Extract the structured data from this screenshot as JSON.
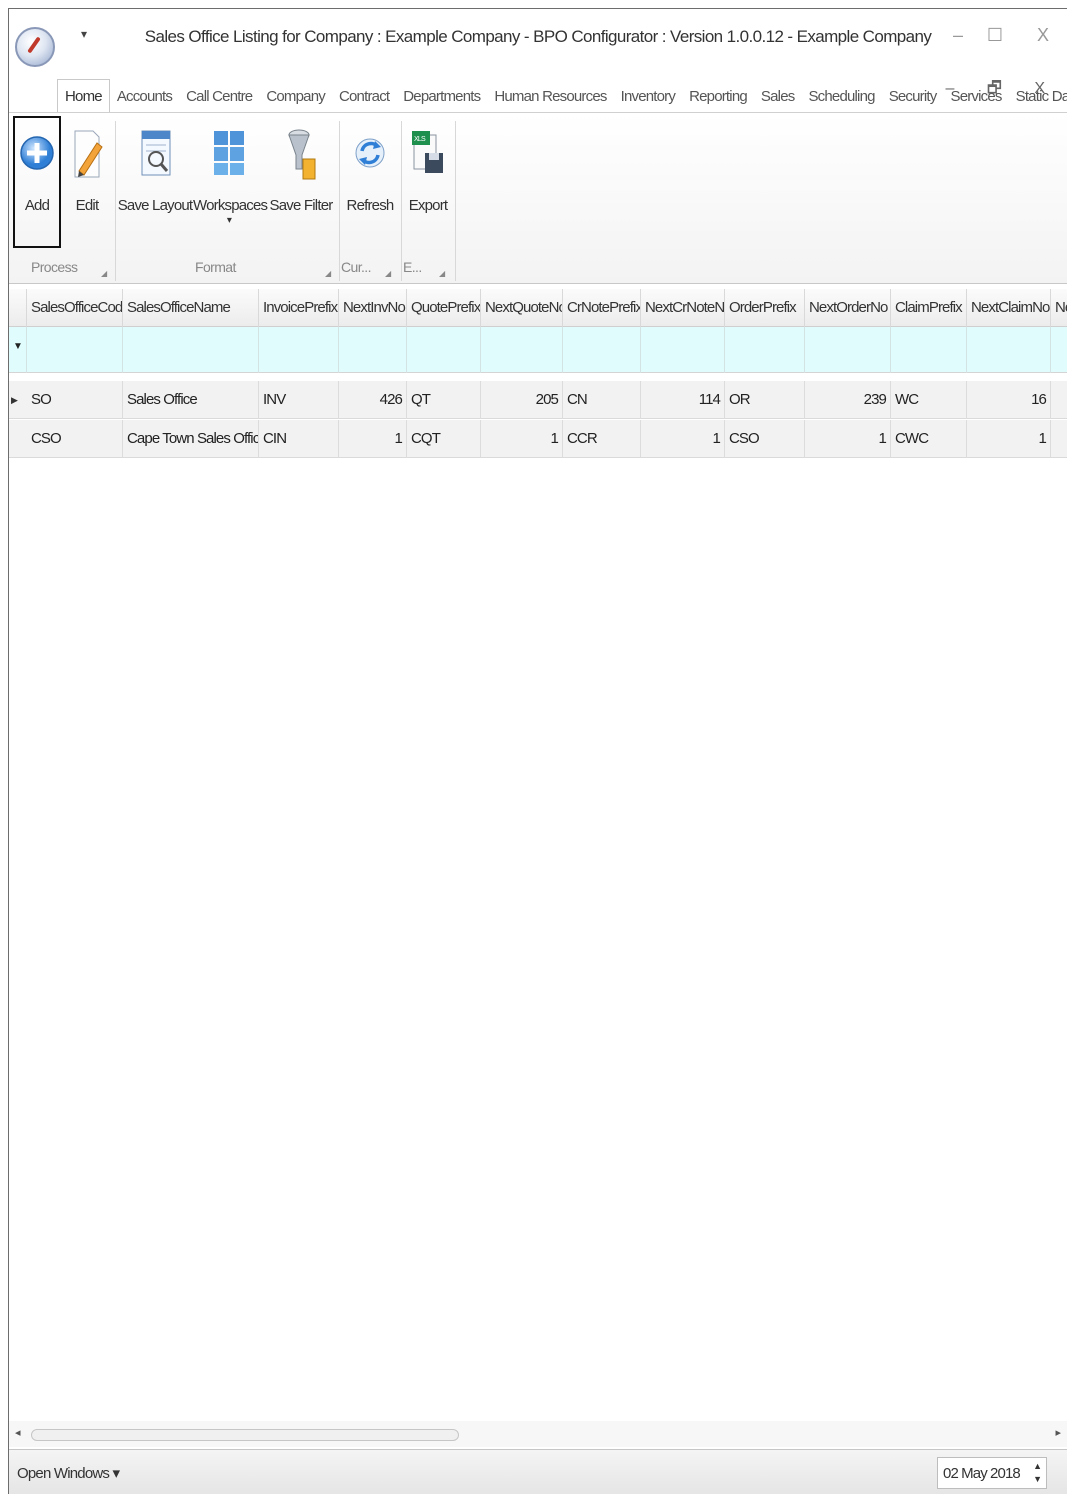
{
  "window": {
    "title": "Sales Office Listing for Company : Example Company - BPO Configurator : Version 1.0.0.12 - Example Company",
    "quick_access": "▾",
    "controls": {
      "minimize": "–",
      "maximize": "☐",
      "close": "X"
    },
    "mdi_controls": "– 🗗 X"
  },
  "tabs": [
    "Home",
    "Accounts",
    "Call Centre",
    "Company",
    "Contract",
    "Departments",
    "Human Resources",
    "Inventory",
    "Reporting",
    "Sales",
    "Scheduling",
    "Security",
    "Services",
    "Static Data"
  ],
  "ribbon": {
    "add": "Add",
    "edit": "Edit",
    "save_layout": "Save Layout",
    "workspaces": "Workspaces",
    "workspaces_arrow": "▾",
    "save_filter": "Save Filter",
    "refresh": "Refresh",
    "export": "Export",
    "groups": {
      "process": "Process",
      "format": "Format",
      "current": "Cur...",
      "export": "E..."
    }
  },
  "grid": {
    "columns": [
      "SalesOfficeCode",
      "SalesOfficeName",
      "InvoicePrefix",
      "NextInvNo",
      "QuotePrefix",
      "NextQuoteNo",
      "CrNotePrefix",
      "NextCrNoteNo",
      "OrderPrefix",
      "NextOrderNo",
      "ClaimPrefix",
      "NextClaimNo",
      "Ne"
    ],
    "rows": [
      [
        "SO",
        "Sales Office",
        "INV",
        "426",
        "QT",
        "205",
        "CN",
        "114",
        "OR",
        "239",
        "WC",
        "16"
      ],
      [
        "CSO",
        "Cape Town Sales Office",
        "CIN",
        "1",
        "CQT",
        "1",
        "CCR",
        "1",
        "CSO",
        "1",
        "CWC",
        "1"
      ]
    ]
  },
  "status": {
    "open_windows": "Open Windows ▾",
    "date": "02 May 2018"
  },
  "colors": {
    "filter_row": "#e0fcfc",
    "row_bg": "#f2f2f2"
  }
}
